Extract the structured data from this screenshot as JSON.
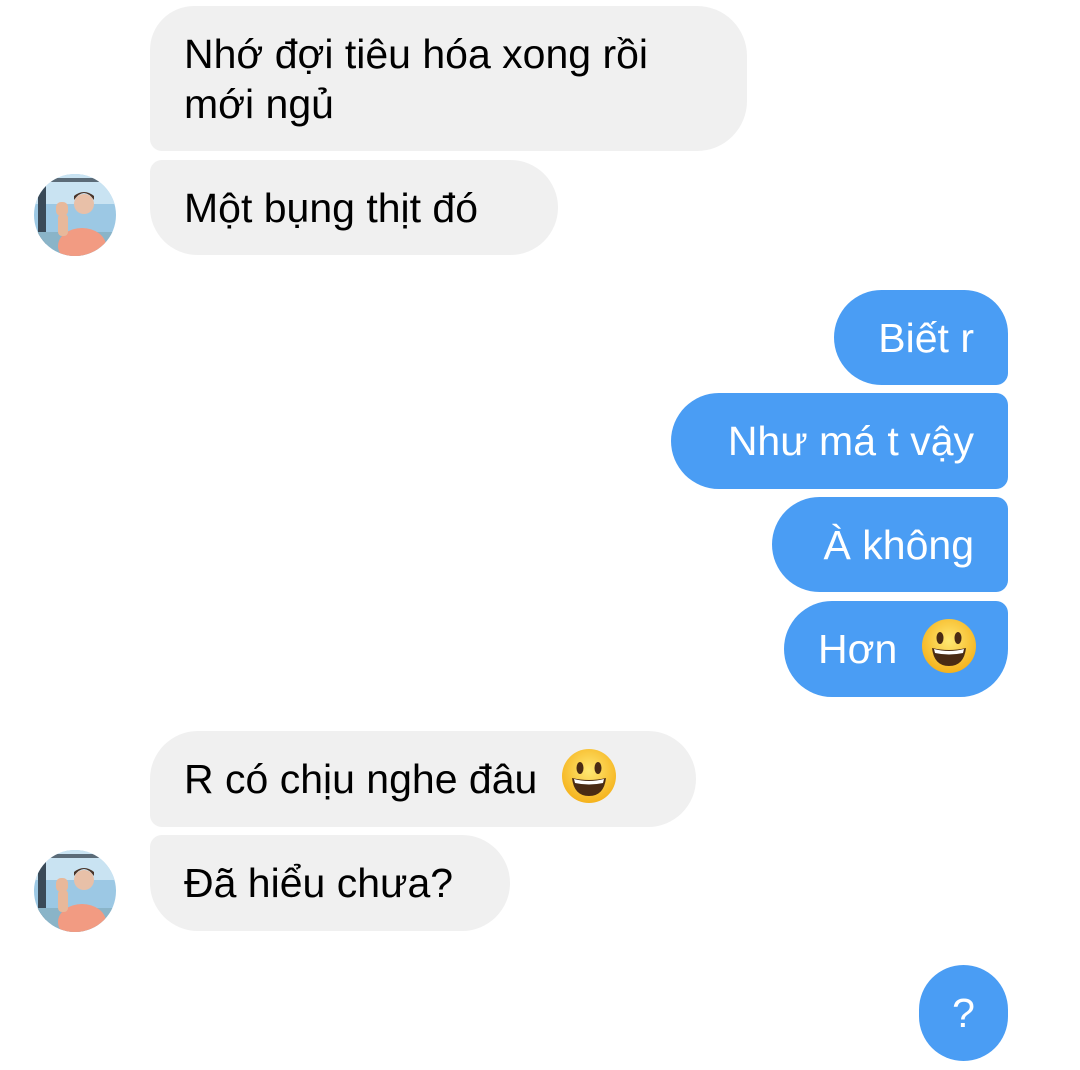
{
  "conversation": {
    "messages": [
      {
        "sender": "them",
        "text_line1": "Nhớ đợi tiêu hóa xong rồi",
        "text_line2": "mới ngủ"
      },
      {
        "sender": "them",
        "text": "Một bụng thịt đó"
      },
      {
        "sender": "me",
        "text": "Biết r"
      },
      {
        "sender": "me",
        "text": "Như má t vậy"
      },
      {
        "sender": "me",
        "text": "À không"
      },
      {
        "sender": "me",
        "text": "Hơn",
        "emoji": "grinning-face-emoji"
      },
      {
        "sender": "them",
        "text": "R có chịu nghe đâu",
        "emoji": "grinning-face-emoji"
      },
      {
        "sender": "them",
        "text": "Đã hiểu chưa?"
      },
      {
        "sender": "me",
        "text": "?"
      }
    ]
  },
  "colors": {
    "incoming_bubble": "#f0f0f0",
    "outgoing_bubble": "#4a9df4",
    "incoming_text": "#000000",
    "outgoing_text": "#ffffff"
  }
}
